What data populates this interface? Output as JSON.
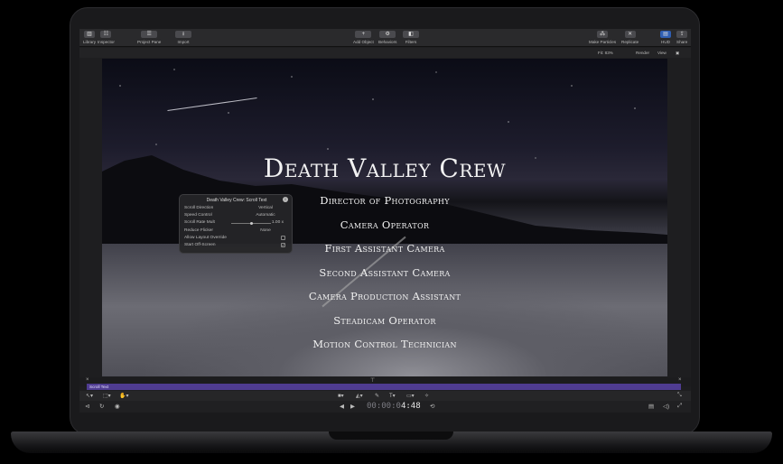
{
  "toolbar": {
    "library": "Library",
    "inspector": "Inspector",
    "project_pane": "Project Pane",
    "import": "Import",
    "add_object": "Add Object",
    "behaviors": "Behaviors",
    "filters": "Filters",
    "make_particles": "Make Particles",
    "replicate": "Replicate",
    "hud": "HUD",
    "share": "Share"
  },
  "view_bar": {
    "fit": "Fit: 83%",
    "render": "Render",
    "view": "View"
  },
  "credits": {
    "title": "Death Valley Crew",
    "roles": [
      "Director of Photography",
      "Camera Operator",
      "First Assistant Camera",
      "Second Assistant Camera",
      "Camera Production Assistant",
      "Steadicam Operator",
      "Motion Control Technician"
    ]
  },
  "hud": {
    "title": "Death Valley Crew: Scroll Text",
    "rows": [
      {
        "label": "Scroll Direction",
        "value": "Vertical"
      },
      {
        "label": "Speed Control",
        "value": "Automatic"
      },
      {
        "label": "Scroll Rate Mult",
        "value": "1.00 x"
      },
      {
        "label": "Reduce Flicker",
        "value": "None"
      },
      {
        "label": "Allow Layout Override",
        "value": ""
      },
      {
        "label": "Start Off-Screen",
        "value": ""
      }
    ],
    "start_off_screen_checked": true,
    "allow_layout_override_checked": false,
    "scroll_rate": 1.0
  },
  "timeline": {
    "track_label": "Scroll Text"
  },
  "transport": {
    "timecode_dim": "00:00:0",
    "timecode_bright": "4:48"
  },
  "colors": {
    "accent": "#2f5fb3",
    "track": "#4f3c91"
  }
}
